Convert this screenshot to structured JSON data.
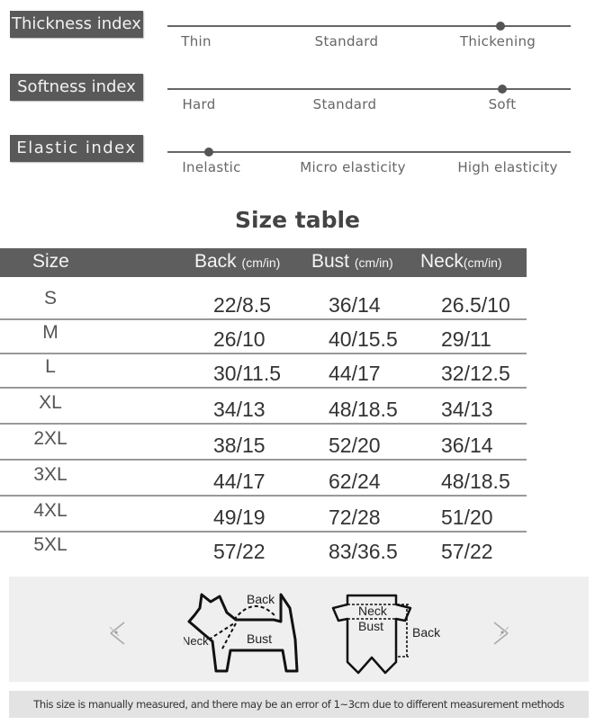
{
  "indices": [
    {
      "label": "Thickness index",
      "options": [
        "Thin",
        "Standard",
        "Thickening"
      ],
      "selected": "Thickening"
    },
    {
      "label": "Softness index",
      "options": [
        "Hard",
        "Standard",
        "Soft"
      ],
      "selected": "Soft"
    },
    {
      "label": "Elastic index",
      "options": [
        "Inelastic",
        "Micro elasticity",
        "High elasticity"
      ],
      "selected": "Inelastic"
    }
  ],
  "size_table": {
    "title": "Size table",
    "headers": [
      {
        "name": "Size",
        "unit": ""
      },
      {
        "name": "Back",
        "unit": "(cm/in)"
      },
      {
        "name": "Bust",
        "unit": "(cm/in)"
      },
      {
        "name": "Neck",
        "unit": "(cm/in)"
      }
    ],
    "rows": [
      [
        "S",
        "22/8.5",
        "36/14",
        "26.5/10"
      ],
      [
        "M",
        "26/10",
        "40/15.5",
        "29/11"
      ],
      [
        "L",
        "30/11.5",
        "44/17",
        "32/12.5"
      ],
      [
        "XL",
        "34/13",
        "48/18.5",
        "34/13"
      ],
      [
        "2XL",
        "38/15",
        "52/20",
        "36/14"
      ],
      [
        "3XL",
        "44/17",
        "62/24",
        "48/18.5"
      ],
      [
        "4XL",
        "49/19",
        "72/28",
        "51/20"
      ],
      [
        "5XL",
        "57/22",
        "83/36.5",
        "57/22"
      ]
    ]
  },
  "diagram": {
    "dog_labels": {
      "back": "Back",
      "neck": "Neck",
      "bust": "Bust"
    },
    "garment_labels": {
      "neck": "Neck",
      "bust": "Bust",
      "back": "Back"
    },
    "prev_icon": "chevron-left-icon",
    "next_icon": "chevron-right-icon"
  },
  "disclaimer": "This size is manually measured, and there may be an error of 1~3cm due to different measurement methods"
}
